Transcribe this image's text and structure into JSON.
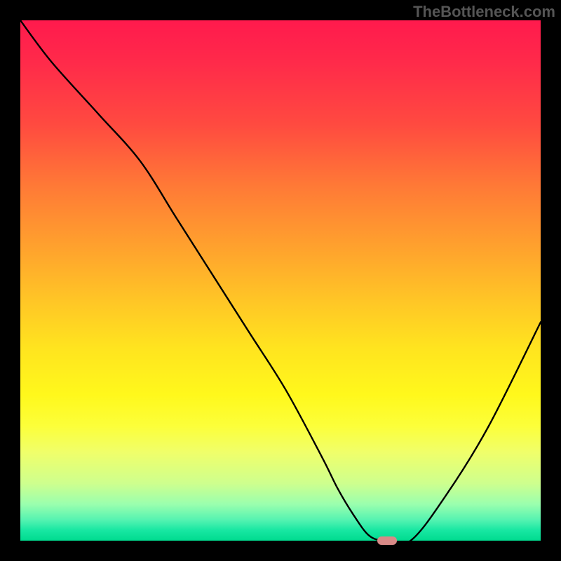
{
  "watermark": "TheBottleneck.com",
  "chart_data": {
    "type": "line",
    "title": "",
    "xlabel": "",
    "ylabel": "",
    "xlim": [
      0,
      100
    ],
    "ylim": [
      0,
      100
    ],
    "series": [
      {
        "name": "curve",
        "x": [
          0,
          6,
          15,
          23,
          30,
          37,
          44,
          51,
          58,
          61,
          64,
          67,
          70,
          75,
          82,
          90,
          100
        ],
        "values": [
          100,
          92,
          82,
          73,
          62,
          51,
          40,
          29,
          16,
          10,
          5,
          1,
          0,
          0,
          9,
          22,
          42
        ]
      }
    ],
    "marker": {
      "x": 70.5,
      "y": 0
    },
    "colors": {
      "curve": "#000000",
      "marker": "#d88a87"
    }
  }
}
